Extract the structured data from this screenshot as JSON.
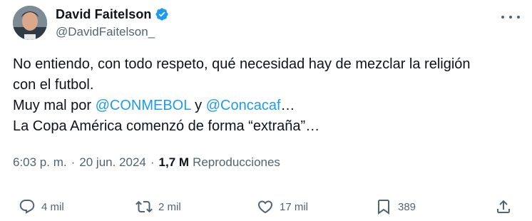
{
  "author": {
    "display_name": "David Faitelson",
    "handle": "@DavidFaitelson_",
    "verified": true,
    "verified_color": "#1d9bf0"
  },
  "tweet": {
    "line1": "No entiendo, con todo respeto, qué necesidad hay de mezclar la religión",
    "line2": "con el futbol.",
    "line3_prefix": "Muy mal por ",
    "mention1": "@CONMEBOL",
    "line3_middle": " y ",
    "mention2": "@Concacaf",
    "line3_suffix": "…",
    "line4": "La Copa América comenzó de forma “extraña”…"
  },
  "meta": {
    "time": "6:03 p. m.",
    "separator": "·",
    "date": "20 jun. 2024",
    "views_count": "1,7 M",
    "views_label": "Reproducciones"
  },
  "actions": {
    "reply": {
      "icon": "reply-icon",
      "count": "4 mil"
    },
    "retweet": {
      "icon": "retweet-icon",
      "count": "2 mil"
    },
    "like": {
      "icon": "heart-icon",
      "count": "17 mil"
    },
    "bookmark": {
      "icon": "bookmark-icon",
      "count": "389"
    },
    "share": {
      "icon": "share-icon"
    }
  },
  "colors": {
    "text": "#0f1419",
    "secondary": "#536471",
    "link": "#1d9bf0"
  }
}
